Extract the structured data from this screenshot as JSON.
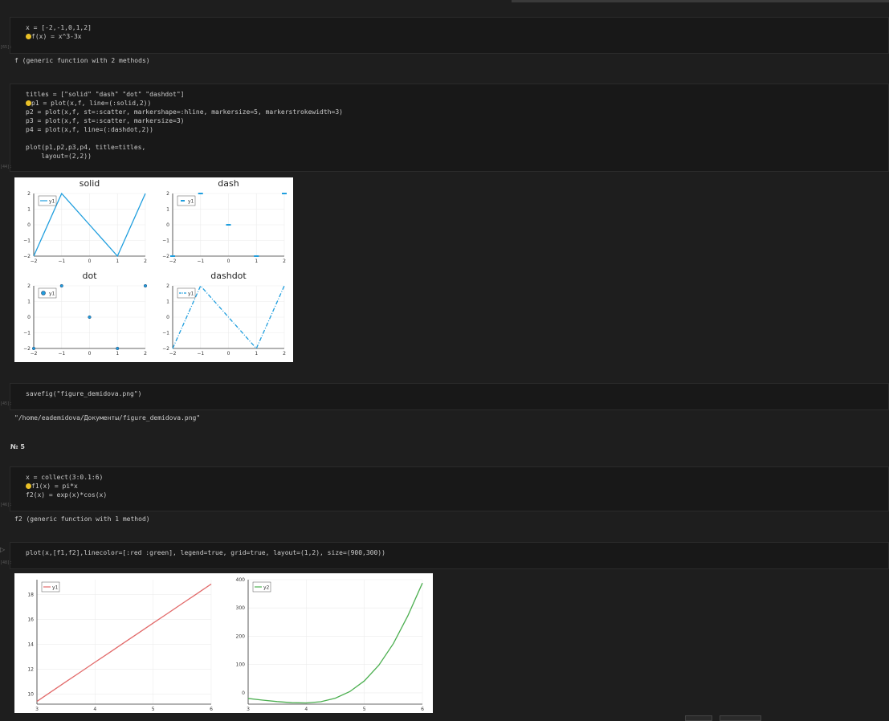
{
  "cells": [
    {
      "type": "code",
      "exec": "[65]:",
      "lines": [
        "x = [-2,-1,0,1,2]",
        "f(x) = x^3-3x"
      ]
    },
    {
      "type": "output",
      "text": "f (generic function with 2 methods)"
    },
    {
      "type": "code",
      "exec": "[44]:",
      "lines": [
        "titles = [\"solid\" \"dash\" \"dot\" \"dashdot\"]",
        "p1 = plot(x,f, line=(:solid,2))",
        "p2 = plot(x,f, st=:scatter, markershape=:hline, markersize=5, markerstrokewidth=3)",
        "p3 = plot(x,f, st=:scatter, markersize=3)",
        "p4 = plot(x,f, line=(:dashdot,2))",
        "",
        "plot(p1,p2,p3,p4, title=titles,",
        "    layout=(2,2))"
      ]
    },
    {
      "type": "code",
      "exec": "[45]:",
      "lines": [
        "savefig(\"figure_demidova.png\")"
      ]
    },
    {
      "type": "output",
      "text": "\"/home/eademidova/Документы/figure_demidova.png\""
    },
    {
      "type": "markdown",
      "text": "№ 5"
    },
    {
      "type": "code",
      "exec": "[46]:",
      "lines": [
        "x = collect(3:0.1:6)",
        "f1(x) = pi*x",
        "f2(x) = exp(x)*cos(x)"
      ]
    },
    {
      "type": "output",
      "text": "f2 (generic function with 1 method)"
    },
    {
      "type": "code",
      "exec": "[48]:",
      "lines": [
        "plot(x,[f1,f2],linecolor=[:red :green], legend=true, grid=true, layout=(1,2), size=(900,300))"
      ]
    }
  ],
  "chart_data": [
    {
      "type": "line",
      "title": "solid",
      "x": [
        -2,
        -1,
        0,
        1,
        2
      ],
      "series": [
        {
          "name": "y1",
          "values": [
            -2,
            2,
            0,
            -2,
            2
          ],
          "style": "solid",
          "color": "#1f9ede"
        }
      ],
      "xlim": [
        -2,
        2
      ],
      "ylim": [
        -2,
        2
      ],
      "xticks": [
        "-2",
        "-1",
        "0",
        "1",
        "2"
      ],
      "yticks": [
        "-2",
        "-1",
        "0",
        "1",
        "2"
      ],
      "grid": true,
      "legend": "top-left"
    },
    {
      "type": "scatter",
      "title": "dash",
      "x": [
        -2,
        -1,
        0,
        1,
        2
      ],
      "series": [
        {
          "name": "y1",
          "values": [
            -2,
            2,
            0,
            -2,
            2
          ],
          "marker": "hline",
          "color": "#1f9ede"
        }
      ],
      "xlim": [
        -2,
        2
      ],
      "ylim": [
        -2,
        2
      ],
      "xticks": [
        "-2",
        "-1",
        "0",
        "1",
        "2"
      ],
      "yticks": [
        "-2",
        "-1",
        "0",
        "1",
        "2"
      ],
      "grid": true,
      "legend": "top-left"
    },
    {
      "type": "scatter",
      "title": "dot",
      "x": [
        -2,
        -1,
        0,
        1,
        2
      ],
      "series": [
        {
          "name": "y1",
          "values": [
            -2,
            2,
            0,
            -2,
            2
          ],
          "marker": "circle",
          "color": "#1f9ede"
        }
      ],
      "xlim": [
        -2,
        2
      ],
      "ylim": [
        -2,
        2
      ],
      "xticks": [
        "-2",
        "-1",
        "0",
        "1",
        "2"
      ],
      "yticks": [
        "-2",
        "-1",
        "0",
        "1",
        "2"
      ],
      "grid": true,
      "legend": "top-left"
    },
    {
      "type": "line",
      "title": "dashdot",
      "x": [
        -2,
        -1,
        0,
        1,
        2
      ],
      "series": [
        {
          "name": "y1",
          "values": [
            -2,
            2,
            0,
            -2,
            2
          ],
          "style": "dashdot",
          "color": "#1f9ede"
        }
      ],
      "xlim": [
        -2,
        2
      ],
      "ylim": [
        -2,
        2
      ],
      "xticks": [
        "-2",
        "-1",
        "0",
        "1",
        "2"
      ],
      "yticks": [
        "-2",
        "-1",
        "0",
        "1",
        "2"
      ],
      "grid": true,
      "legend": "top-left"
    },
    {
      "type": "line",
      "title": "",
      "x": [
        3,
        3.25,
        3.5,
        3.75,
        4,
        4.25,
        4.5,
        4.75,
        5,
        5.25,
        5.5,
        5.75,
        6
      ],
      "series": [
        {
          "name": "y1",
          "values": [
            9.42,
            10.21,
            11.0,
            11.78,
            12.57,
            13.35,
            14.14,
            14.92,
            15.71,
            16.49,
            17.28,
            18.06,
            18.85
          ],
          "color": "#e26a6a"
        }
      ],
      "xlim": [
        3,
        6
      ],
      "ylim": [
        9.2,
        19.2
      ],
      "xticks": [
        "3",
        "4",
        "5",
        "6"
      ],
      "yticks": [
        "10",
        "12",
        "14",
        "16",
        "18"
      ],
      "grid": true,
      "legend": "top-left"
    },
    {
      "type": "line",
      "title": "",
      "x": [
        3,
        3.25,
        3.5,
        3.75,
        4,
        4.25,
        4.5,
        4.75,
        5,
        5.25,
        5.5,
        5.75,
        6
      ],
      "series": [
        {
          "name": "y2",
          "values": [
            -19.9,
            -25.8,
            -31.0,
            -34.9,
            -35.7,
            -31.5,
            -19.0,
            4.4,
            42.1,
            97.8,
            174.1,
            272.7,
            388.1
          ],
          "color": "#4caf50"
        }
      ],
      "xlim": [
        3,
        6
      ],
      "ylim": [
        -40,
        400
      ],
      "xticks": [
        "3",
        "4",
        "5",
        "6"
      ],
      "yticks": [
        "0",
        "100",
        "200",
        "300",
        "400"
      ],
      "grid": true,
      "legend": "top-left"
    }
  ]
}
